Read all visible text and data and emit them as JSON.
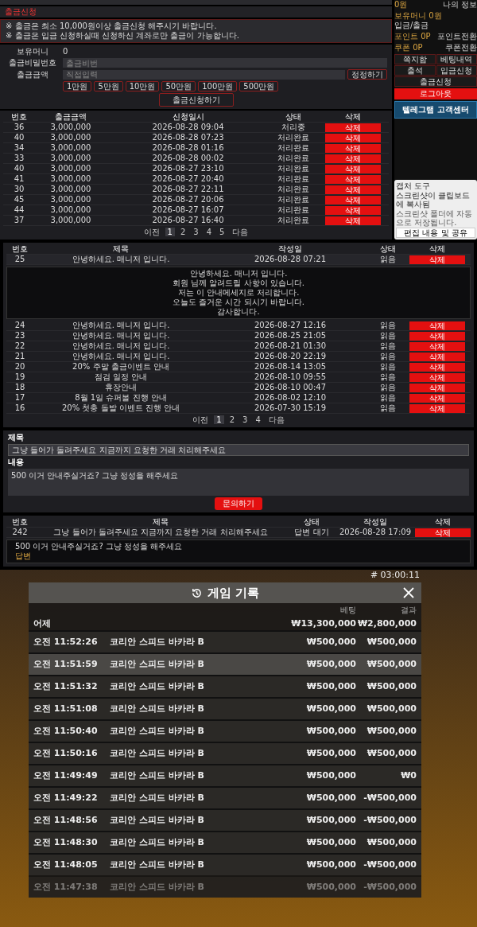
{
  "withdraw": {
    "title": "출금신청",
    "notices": [
      "※ 출금은 최소 10,000원이상 출금신청 해주시기 바랍니다.",
      "※ 출금은 입금 신청하실때 신청하신 계좌로만 출금이 가능합니다."
    ],
    "balance_label": "보유머니",
    "balance_value": "0",
    "password_label": "출금비밀번호",
    "password_placeholder": "출금비번",
    "amount_label": "출금금액",
    "amount_placeholder": "직접입력",
    "reset_button": "정정하기",
    "amount_buttons": [
      "1만원",
      "5만원",
      "10만원",
      "50만원",
      "100만원",
      "500만원"
    ],
    "submit": "출금신청하기",
    "columns": [
      "번호",
      "출금금액",
      "신청일시",
      "상태",
      "삭제"
    ],
    "rows": [
      {
        "no": "36",
        "amount": "3,000,000",
        "date": "2026-08-28 09:04",
        "status": "처리중",
        "action": "삭제"
      },
      {
        "no": "40",
        "amount": "3,000,000",
        "date": "2026-08-28 07:23",
        "status": "처리완료",
        "action": "삭제"
      },
      {
        "no": "34",
        "amount": "3,000,000",
        "date": "2026-08-28 01:16",
        "status": "처리완료",
        "action": "삭제"
      },
      {
        "no": "33",
        "amount": "3,000,000",
        "date": "2026-08-28 00:02",
        "status": "처리완료",
        "action": "삭제"
      },
      {
        "no": "40",
        "amount": "3,000,000",
        "date": "2026-08-27 23:10",
        "status": "처리완료",
        "action": "삭제"
      },
      {
        "no": "41",
        "amount": "3,000,000",
        "date": "2026-08-27 20:40",
        "status": "처리완료",
        "action": "삭제"
      },
      {
        "no": "30",
        "amount": "3,000,000",
        "date": "2026-08-27 22:11",
        "status": "처리완료",
        "action": "삭제"
      },
      {
        "no": "45",
        "amount": "3,000,000",
        "date": "2026-08-27 20:06",
        "status": "처리완료",
        "action": "삭제"
      },
      {
        "no": "44",
        "amount": "3,000,000",
        "date": "2026-08-27 16:07",
        "status": "처리완료",
        "action": "삭제"
      },
      {
        "no": "37",
        "amount": "3,000,000",
        "date": "2026-08-27 16:40",
        "status": "처리완료",
        "action": "삭제"
      }
    ],
    "pagination": [
      {
        "label": "이전",
        "selected": false
      },
      {
        "label": "1",
        "selected": true
      },
      {
        "label": "2",
        "selected": false
      },
      {
        "label": "3",
        "selected": false
      },
      {
        "label": "4",
        "selected": false
      },
      {
        "label": "5",
        "selected": false
      },
      {
        "label": "다음",
        "selected": false
      }
    ]
  },
  "sidebar": {
    "rows": [
      {
        "label": "0원",
        "value": "나의 정보"
      },
      {
        "label": "보유머니 0원",
        "value": "입금/출금"
      },
      {
        "label": "포인트 0P",
        "value": "포인트전환"
      },
      {
        "label": "쿠폰 0P",
        "value": "쿠폰전환"
      }
    ],
    "buttons": [
      "쪽지함",
      "베팅내역",
      "출석",
      "입금신청",
      "출금신청"
    ],
    "logout": "로그아웃",
    "banner": "텔레그램 고객센터"
  },
  "toast": {
    "app": "캡처 도구",
    "message": "스크린샷이 클립보드에 복사됨",
    "detail": "스크린샷 폴더에 자동으로 저장됩니다.",
    "button": "편집 내용 및 공유"
  },
  "notices_board": {
    "columns": [
      "번호",
      "제목",
      "작성일",
      "상태",
      "삭제"
    ],
    "rows": [
      {
        "no": "25",
        "title": "안녕하세요. 매니저 입니다.",
        "date": "2026-08-28 07:21",
        "status": "읽음",
        "action": "삭제",
        "body": [
          "안녕하세요. 매니저 입니다.",
          "회원 님께 알려드릴 사항이 있습니다.",
          "저는 이 안내메세지로 처리합니다.",
          "오늘도 즐거운 시간 되시기 바랍니다.",
          "감사합니다."
        ]
      },
      {
        "no": "24",
        "title": "안녕하세요. 매니저 입니다.",
        "date": "2026-08-27 12:16",
        "status": "읽음",
        "action": "삭제"
      },
      {
        "no": "23",
        "title": "안녕하세요. 매니저 입니다.",
        "date": "2026-08-25 21:05",
        "status": "읽음",
        "action": "삭제"
      },
      {
        "no": "22",
        "title": "안녕하세요. 매니저 입니다.",
        "date": "2026-08-21 01:30",
        "status": "읽음",
        "action": "삭제"
      },
      {
        "no": "21",
        "title": "안녕하세요. 매니저 입니다.",
        "date": "2026-08-20 22:19",
        "status": "읽음",
        "action": "삭제"
      },
      {
        "no": "20",
        "title": "20% 주말 출금이벤트 안내",
        "date": "2026-08-14 13:05",
        "status": "읽음",
        "action": "삭제"
      },
      {
        "no": "19",
        "title": "점검 일정 안내",
        "date": "2026-08-10 09:55",
        "status": "읽음",
        "action": "삭제"
      },
      {
        "no": "18",
        "title": "휴장안내",
        "date": "2026-08-10 00:47",
        "status": "읽음",
        "action": "삭제"
      },
      {
        "no": "17",
        "title": "8월 1일 슈퍼볼 진행 안내",
        "date": "2026-08-02 12:10",
        "status": "읽음",
        "action": "삭제"
      },
      {
        "no": "16",
        "title": "20% 첫충 돌발 이벤트 진행 안내",
        "date": "2026-07-30 15:19",
        "status": "읽음",
        "action": "삭제"
      }
    ],
    "pagination": [
      {
        "label": "이전",
        "selected": false
      },
      {
        "label": "1",
        "selected": true
      },
      {
        "label": "2",
        "selected": false
      },
      {
        "label": "3",
        "selected": false
      },
      {
        "label": "4",
        "selected": false
      },
      {
        "label": "다음",
        "selected": false
      }
    ]
  },
  "inquiry_form": {
    "subject_label": "제목",
    "subject_value": "그냥 들어가 돌려주세요 지금까지 요청한 거래 처리해주세요",
    "content_label": "내용",
    "content_value": "500 이거 안내주실거죠? 그냥 정성을 해주세요",
    "submit": "문의하기"
  },
  "inquiries": {
    "columns": [
      "번호",
      "제목",
      "상태",
      "작성일",
      "삭제"
    ],
    "rows": [
      {
        "no": "242",
        "title": "그냥 들어가 돌려주세요 지금까지 요청한 거래 처리해주세요",
        "status": "답변 대기",
        "date": "2026-08-28 17:09",
        "action": "삭제",
        "body": "500 이거 안내주실거죠? 그냥 정성을 해주세요",
        "reply": "답변"
      }
    ]
  },
  "game_record": {
    "timer": "# 03:00:11",
    "title": "게임 기록",
    "columns": [
      "베팅",
      "결과"
    ],
    "summary": {
      "label": "어제",
      "bet": "₩13,300,000",
      "result": "₩2,800,000"
    },
    "rows": [
      {
        "time": "오전 11:52:26",
        "game": "코리안 스피드 바카라 B",
        "bet": "₩500,000",
        "result": "₩500,000",
        "selected": false,
        "faded": false
      },
      {
        "time": "오전 11:51:59",
        "game": "코리안 스피드 바카라 B",
        "bet": "₩500,000",
        "result": "₩500,000",
        "selected": true,
        "faded": false
      },
      {
        "time": "오전 11:51:32",
        "game": "코리안 스피드 바카라 B",
        "bet": "₩500,000",
        "result": "₩500,000",
        "selected": false,
        "faded": false
      },
      {
        "time": "오전 11:51:08",
        "game": "코리안 스피드 바카라 B",
        "bet": "₩500,000",
        "result": "₩500,000",
        "selected": false,
        "faded": false
      },
      {
        "time": "오전 11:50:40",
        "game": "코리안 스피드 바카라 B",
        "bet": "₩500,000",
        "result": "₩500,000",
        "selected": false,
        "faded": false
      },
      {
        "time": "오전 11:50:16",
        "game": "코리안 스피드 바카라 B",
        "bet": "₩500,000",
        "result": "₩500,000",
        "selected": false,
        "faded": false
      },
      {
        "time": "오전 11:49:49",
        "game": "코리안 스피드 바카라 B",
        "bet": "₩500,000",
        "result": "₩0",
        "selected": false,
        "faded": false
      },
      {
        "time": "오전 11:49:22",
        "game": "코리안 스피드 바카라 B",
        "bet": "₩500,000",
        "result": "-₩500,000",
        "selected": false,
        "faded": false
      },
      {
        "time": "오전 11:48:56",
        "game": "코리안 스피드 바카라 B",
        "bet": "₩500,000",
        "result": "-₩500,000",
        "selected": false,
        "faded": false
      },
      {
        "time": "오전 11:48:30",
        "game": "코리안 스피드 바카라 B",
        "bet": "₩500,000",
        "result": "₩500,000",
        "selected": false,
        "faded": false
      },
      {
        "time": "오전 11:48:05",
        "game": "코리안 스피드 바카라 B",
        "bet": "₩500,000",
        "result": "-₩500,000",
        "selected": false,
        "faded": false
      },
      {
        "time": "오전 11:47:38",
        "game": "코리안 스피드 바카라 B",
        "bet": "₩500,000",
        "result": "-₩500,000",
        "selected": false,
        "faded": true
      }
    ]
  }
}
